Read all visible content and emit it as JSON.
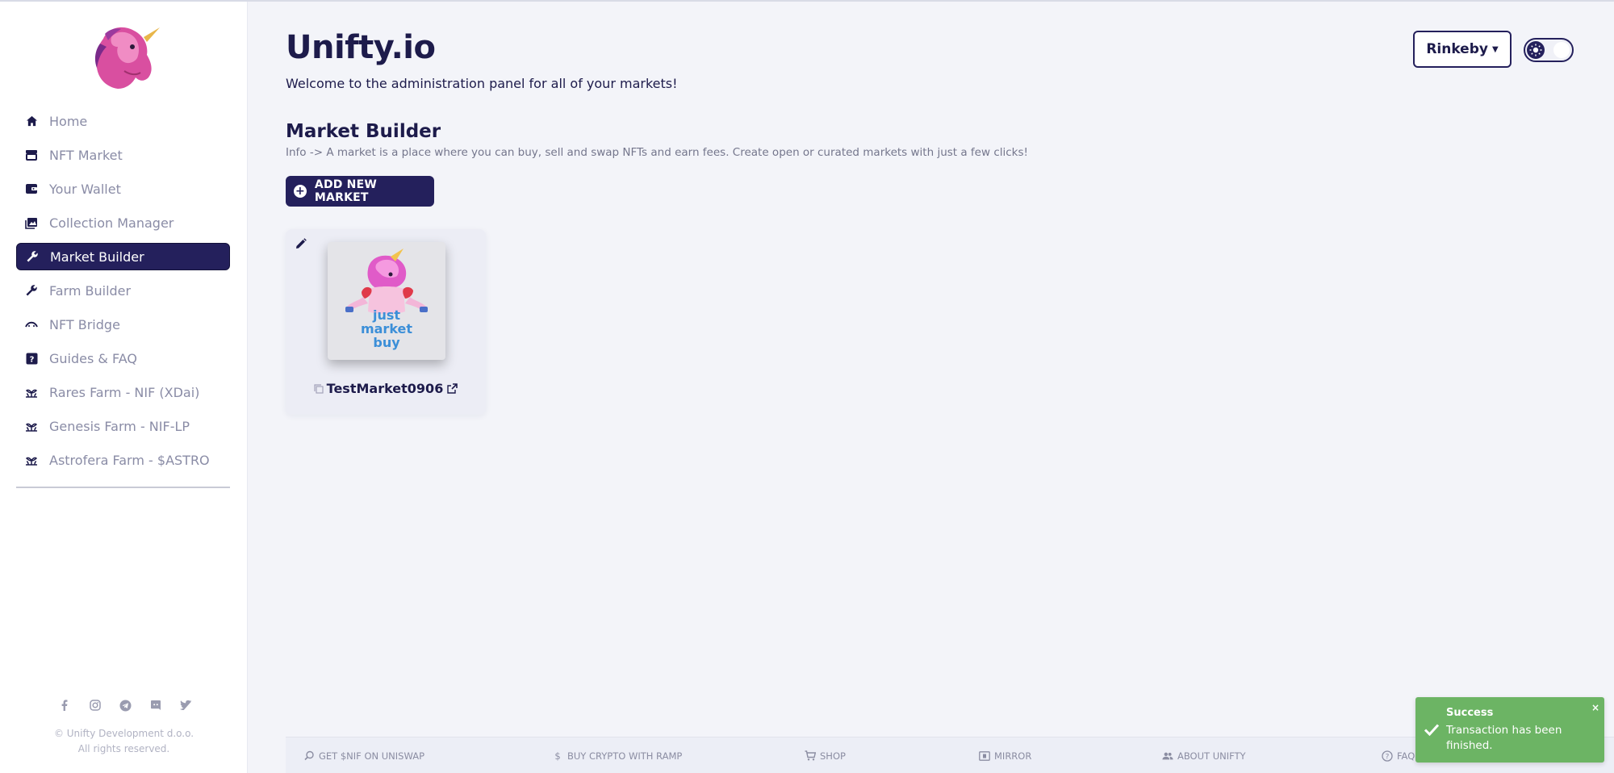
{
  "app": {
    "title": "Unifty.io",
    "subtitle": "Welcome to the administration panel for all of your markets!"
  },
  "sidebar": {
    "items": [
      {
        "label": "Home",
        "icon": "home-icon",
        "active": false
      },
      {
        "label": "NFT Market",
        "icon": "store-icon",
        "active": false
      },
      {
        "label": "Your Wallet",
        "icon": "wallet-icon",
        "active": false
      },
      {
        "label": "Collection Manager",
        "icon": "collection-icon",
        "active": false
      },
      {
        "label": "Market Builder",
        "icon": "wrench-icon",
        "active": true
      },
      {
        "label": "Farm Builder",
        "icon": "wrench-icon",
        "active": false
      },
      {
        "label": "NFT Bridge",
        "icon": "bridge-icon",
        "active": false
      },
      {
        "label": "Guides & FAQ",
        "icon": "help-icon",
        "active": false
      },
      {
        "label": "Rares Farm - NIF (XDai)",
        "icon": "farm-icon",
        "active": false
      },
      {
        "label": "Genesis Farm - NIF-LP",
        "icon": "farm-icon",
        "active": false
      },
      {
        "label": "Astrofera Farm - $ASTRO",
        "icon": "farm-icon",
        "active": false
      }
    ],
    "socials": [
      "facebook-icon",
      "instagram-icon",
      "telegram-icon",
      "discord-icon",
      "twitter-icon"
    ],
    "copyright_line1": "© Unifty Development d.o.o.",
    "copyright_line2": "All rights reserved."
  },
  "main": {
    "section_title": "Market Builder",
    "section_info": "Info -> A market is a place where you can buy, sell and swap NFTs and earn fees. Create open or curated markets with just a few clicks!",
    "add_button_label": "ADD NEW MARKET",
    "markets": [
      {
        "name": "TestMarket0906",
        "thumb_text": [
          "just",
          "market",
          "buy"
        ]
      }
    ]
  },
  "header": {
    "network_label": "Rinkeby"
  },
  "footer": {
    "links": [
      {
        "label": "GET $NIF ON UNISWAP",
        "icon": "uniswap-search-icon"
      },
      {
        "label": "BUY CRYPTO WITH RAMP",
        "icon": "dollar-icon"
      },
      {
        "label": "SHOP",
        "icon": "cart-icon"
      },
      {
        "label": "MIRROR",
        "icon": "mirror-icon"
      },
      {
        "label": "ABOUT UNIFTY",
        "icon": "people-icon"
      },
      {
        "label": "FAQ",
        "icon": "question-icon"
      }
    ]
  },
  "toast": {
    "title": "Success",
    "message": "Transaction has been finished.",
    "close": "×"
  },
  "colors": {
    "brand_dark": "#24205c",
    "background": "#f3f4f9",
    "success": "#6cb464"
  }
}
